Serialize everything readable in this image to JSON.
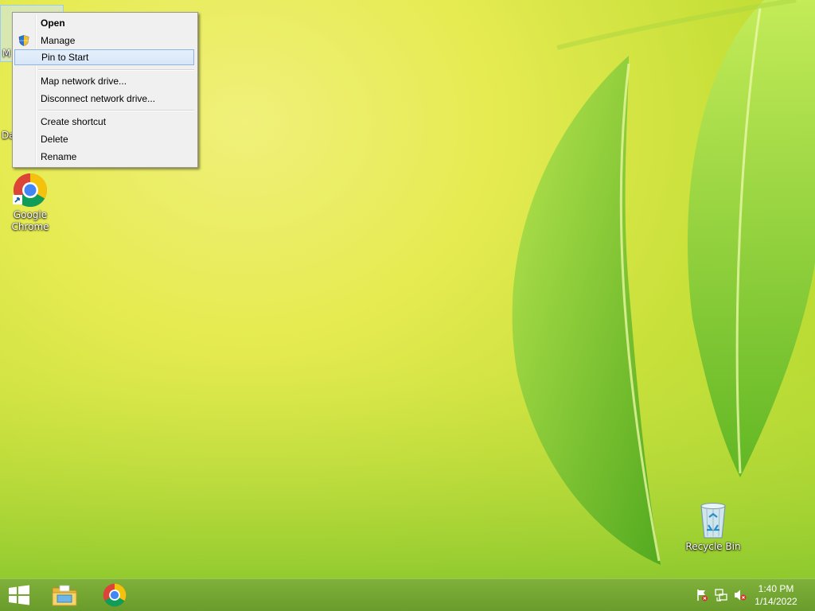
{
  "desktop": {
    "partial_icon_1": "M",
    "partial_icon_2": "Da",
    "chrome_icon": {
      "label_line1": "Google",
      "label_line2": "Chrome",
      "icon": "chrome-icon"
    },
    "recycle_bin": {
      "label": "Recycle Bin",
      "icon": "recycle-bin-icon"
    }
  },
  "context_menu": {
    "items": [
      {
        "label": "Open"
      },
      {
        "label": "Manage"
      },
      {
        "label": "Pin to Start"
      },
      {
        "label": "Map network drive..."
      },
      {
        "label": "Disconnect network drive..."
      },
      {
        "label": "Create shortcut"
      },
      {
        "label": "Delete"
      },
      {
        "label": "Rename"
      }
    ]
  },
  "taskbar": {
    "start_icon": "windows-logo-icon",
    "pinned": [
      "file-explorer-icon",
      "chrome-icon"
    ],
    "tray": [
      "action-center-flag-icon",
      "network-icon",
      "volume-muted-icon"
    ],
    "clock": {
      "time": "1:40 PM",
      "date": "1/14/2022"
    }
  },
  "colors": {
    "taskbar": "#6fa030",
    "menu_bg": "#f0f0f0",
    "menu_hover": "#d7e6f8"
  }
}
